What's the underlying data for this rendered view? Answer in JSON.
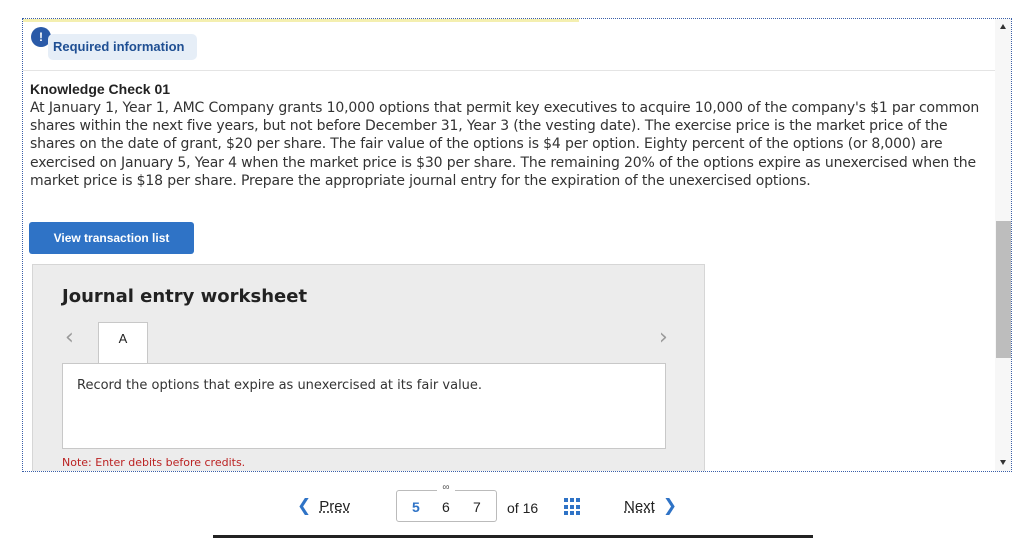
{
  "header": {
    "alert_icon": "!",
    "required_tab": "Required information"
  },
  "question": {
    "title": "Knowledge Check 01",
    "text": "At January 1, Year 1, AMC Company grants 10,000 options that permit key executives to acquire 10,000 of the company's $1 par common shares within the next five years, but not before December 31, Year 3 (the vesting date). The exercise price is the market price of the shares on the date of grant, $20 per share. The fair value of the options is $4 per option. Eighty percent of the options (or 8,000) are exercised on January 5, Year 4 when the market price is $30 per share. The remaining 20% of the options expire as unexercised when the market price is $18 per share. Prepare the appropriate journal entry for the expiration of the unexercised options."
  },
  "view_transactions_label": "View transaction list",
  "worksheet": {
    "title": "Journal entry worksheet",
    "prev_arrow": "‹",
    "next_arrow": "›",
    "tab_label": "A",
    "instruction": "Record the options that expire as unexercised at its fair value.",
    "note": "Note: Enter debits before credits."
  },
  "pagination": {
    "prev_label": "Prev",
    "next_label": "Next",
    "pages": [
      "5",
      "6",
      "7"
    ],
    "current_page": "5",
    "of_total": "of 16"
  },
  "colors": {
    "accent": "#2f73c6",
    "note_red": "#b22222",
    "required_bg": "#e6eef7"
  }
}
